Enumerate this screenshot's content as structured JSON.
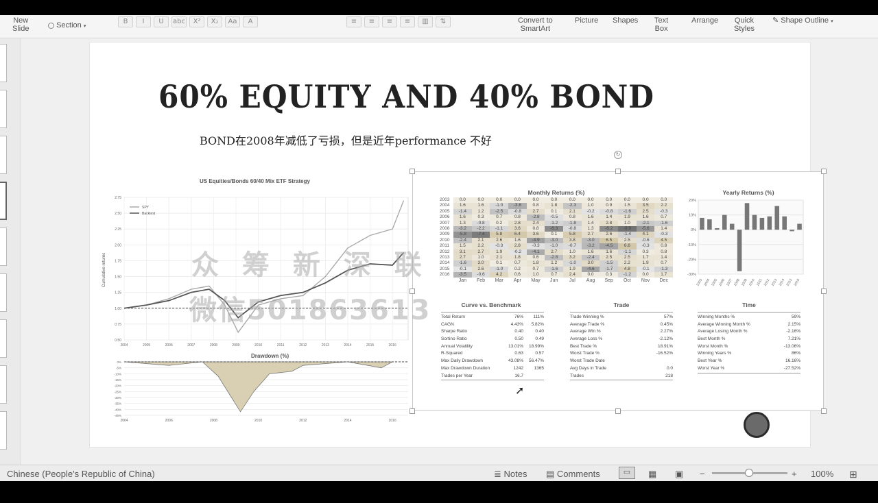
{
  "ribbon": {
    "new_slide": "New\nSlide",
    "section": "Section",
    "format_icons": [
      "B",
      "I",
      "U",
      "abc",
      "X²",
      "X₂",
      "Aa",
      "A"
    ],
    "convert_smartart": "Convert to\nSmartArt",
    "picture": "Picture",
    "shapes": "Shapes",
    "text_box": "Text\nBox",
    "arrange": "Arrange",
    "quick_styles": "Quick\nStyles",
    "shape_outline": "Shape Outline"
  },
  "slide": {
    "title": "60% EQUITY AND 40% BOND",
    "subtitle": "BOND在2008年减低了亏损，但是近年performance 不好"
  },
  "left_chart": {
    "title": "US Equities/Bonds 60/40 Mix ETF Strategy",
    "ylabel": "Cumulative returns",
    "legend": [
      "SPY",
      "Backtest"
    ],
    "yticks": [
      "2.75",
      "2.50",
      "2.25",
      "2.00",
      "1.75",
      "1.50",
      "1.25",
      "1.00",
      "0.75",
      "0.50"
    ],
    "xticks": [
      "2004",
      "2005",
      "2006",
      "2007",
      "2008",
      "2009",
      "2010",
      "2011",
      "2012",
      "2013",
      "2014",
      "2015",
      "2016"
    ],
    "drawdown_title": "Drawdown (%)",
    "dd_yticks": [
      "0%",
      "-5%",
      "-10%",
      "-15%",
      "-20%",
      "-25%",
      "-30%",
      "-35%",
      "-40%",
      "-45%"
    ],
    "dd_xticks": [
      "2004",
      "2006",
      "2008",
      "2010",
      "2012",
      "2014",
      "2016"
    ]
  },
  "chart_data": [
    {
      "type": "line",
      "title": "US Equities/Bonds 60/40 Mix ETF Strategy",
      "ylabel": "Cumulative returns",
      "ylim": [
        0.5,
        2.75
      ],
      "x": [
        2004,
        2005,
        2006,
        2007,
        2007.8,
        2008.5,
        2009.1,
        2010,
        2011,
        2012,
        2013,
        2014,
        2015,
        2016,
        2016.5
      ],
      "series": [
        {
          "name": "SPY",
          "values": [
            1.0,
            1.05,
            1.15,
            1.3,
            1.35,
            1.05,
            0.62,
            1.05,
            1.15,
            1.2,
            1.5,
            1.95,
            2.15,
            2.25,
            2.7
          ]
        },
        {
          "name": "Backtest",
          "values": [
            1.0,
            1.05,
            1.12,
            1.25,
            1.3,
            1.12,
            0.85,
            1.1,
            1.2,
            1.25,
            1.4,
            1.6,
            1.7,
            1.68,
            1.88
          ]
        }
      ]
    },
    {
      "type": "area",
      "title": "Drawdown (%)",
      "ylim": [
        -45,
        0
      ],
      "x": [
        2004,
        2006,
        2007.5,
        2008.2,
        2008.8,
        2009.2,
        2009.8,
        2010.5,
        2011.5,
        2012,
        2014,
        2015.5,
        2016
      ],
      "values": [
        0,
        -3,
        0,
        -12,
        -30,
        -42,
        -25,
        -10,
        -8,
        -3,
        0,
        -5,
        0
      ]
    },
    {
      "type": "bar",
      "title": "Yearly Returns (%)",
      "categories": [
        "2003",
        "2004",
        "2005",
        "2006",
        "2007",
        "2008",
        "2009",
        "2010",
        "2011",
        "2012",
        "2013",
        "2014",
        "2015",
        "2016"
      ],
      "values": [
        8,
        7,
        1,
        10,
        4,
        -28,
        18,
        10,
        8,
        9,
        16,
        9,
        -1,
        4
      ],
      "yticks": [
        "20%",
        "10%",
        "0%",
        "-10%",
        "-20%",
        "-30%"
      ],
      "ylim": [
        -30,
        20
      ]
    }
  ],
  "monthly_returns": {
    "title": "Monthly Returns (%)",
    "months": [
      "Jan",
      "Feb",
      "Mar",
      "Apr",
      "May",
      "Jun",
      "Jul",
      "Aug",
      "Sep",
      "Oct",
      "Nov",
      "Dec"
    ],
    "rows": [
      {
        "year": "2003",
        "cells": [
          "0.0",
          "0.0",
          "0.0",
          "0.0",
          "0.0",
          "0.0",
          "0.0",
          "0.0",
          "0.0",
          "0.0",
          "0.0",
          "0.0"
        ]
      },
      {
        "year": "2004",
        "cells": [
          "1.6",
          "1.6",
          "-1.0",
          "-3.8",
          "0.8",
          "1.8",
          "-2.3",
          "1.0",
          "0.9",
          "1.5",
          "3.5",
          "2.2"
        ]
      },
      {
        "year": "2005",
        "cells": [
          "-1.4",
          "1.2",
          "-2.5",
          "-0.8",
          "2.7",
          "0.1",
          "2.1",
          "-0.2",
          "-0.8",
          "-1.6",
          "2.5",
          "-0.3"
        ]
      },
      {
        "year": "2006",
        "cells": [
          "1.6",
          "0.3",
          "0.7",
          "0.8",
          "-2.8",
          "-0.5",
          "0.8",
          "1.6",
          "1.4",
          "1.9",
          "1.6",
          "0.7"
        ]
      },
      {
        "year": "2007",
        "cells": [
          "1.3",
          "-0.8",
          "0.2",
          "2.8",
          "2.4",
          "-1.2",
          "-1.8",
          "1.4",
          "2.8",
          "1.0",
          "-2.1",
          "-1.6"
        ]
      },
      {
        "year": "2008",
        "cells": [
          "-3.2",
          "-2.2",
          "-1.1",
          "3.6",
          "0.8",
          "-6.3",
          "-0.8",
          "1.3",
          "-6.2",
          "-9.9",
          "-5.6",
          "1.4"
        ]
      },
      {
        "year": "2009",
        "cells": [
          "-5.8",
          "-7.4",
          "5.8",
          "6.4",
          "3.6",
          "0.1",
          "5.8",
          "2.7",
          "2.6",
          "-1.4",
          "4.1",
          "-0.3"
        ]
      },
      {
        "year": "2010",
        "cells": [
          "-2.4",
          "2.1",
          "2.6",
          "1.6",
          "-4.9",
          "-3.0",
          "3.8",
          "-3.0",
          "6.5",
          "2.5",
          "-0.6",
          "4.5"
        ]
      },
      {
        "year": "2011",
        "cells": [
          "1.5",
          "2.2",
          "-0.3",
          "2.8",
          "-0.3",
          "-1.0",
          "-0.7",
          "-3.2",
          "-4.5",
          "6.6",
          "-0.3",
          "0.8"
        ]
      },
      {
        "year": "2012",
        "cells": [
          "3.1",
          "2.7",
          "1.9",
          "-0.2",
          "-4.1",
          "2.7",
          "1.0",
          "1.6",
          "1.6",
          "-1.1",
          "0.3",
          "0.8"
        ]
      },
      {
        "year": "2013",
        "cells": [
          "2.7",
          "1.0",
          "2.1",
          "1.8",
          "0.6",
          "-2.8",
          "3.2",
          "-2.4",
          "2.5",
          "2.5",
          "1.7",
          "1.4"
        ]
      },
      {
        "year": "2014",
        "cells": [
          "-1.6",
          "3.0",
          "0.1",
          "0.7",
          "1.8",
          "1.2",
          "-1.0",
          "3.0",
          "-1.5",
          "2.2",
          "1.9",
          "0.7"
        ]
      },
      {
        "year": "2015",
        "cells": [
          "-0.1",
          "2.6",
          "-1.0",
          "0.2",
          "0.7",
          "-1.6",
          "1.9",
          "-4.6",
          "-1.7",
          "4.8",
          "-0.1",
          "-1.3"
        ]
      },
      {
        "year": "2016",
        "cells": [
          "-3.5",
          "-0.6",
          "4.2",
          "0.6",
          "1.0",
          "0.7",
          "2.4",
          "0.0",
          "0.3",
          "-1.2",
          "0.0",
          "1.7"
        ]
      }
    ]
  },
  "yearly_returns_title": "Yearly Returns (%)",
  "curve_vs_benchmark": {
    "title": "Curve vs. Benchmark",
    "rows": [
      {
        "label": "Total Return",
        "a": "76%",
        "b": "111%"
      },
      {
        "label": "CAGN",
        "a": "4.43%",
        "b": "5.82%"
      },
      {
        "label": "Sharpe Ratio",
        "a": "0.40",
        "b": "0.40"
      },
      {
        "label": "Sortino Ratio",
        "a": "0.50",
        "b": "0.49"
      },
      {
        "label": "Annual Volatility",
        "a": "13.01%",
        "b": "18.99%"
      },
      {
        "label": "R-Squared",
        "a": "0.63",
        "b": "0.57"
      },
      {
        "label": "Max Daily Drawdown",
        "a": "43.08%",
        "b": "56.47%"
      },
      {
        "label": "Max Drawdown Duration",
        "a": "1242",
        "b": "1365"
      },
      {
        "label": "Trades per Year",
        "a": "16.7",
        "b": ""
      }
    ]
  },
  "trade": {
    "title": "Trade",
    "rows": [
      {
        "label": "Trade Winning %",
        "v": "57%"
      },
      {
        "label": "Average Trade %",
        "v": "0.45%"
      },
      {
        "label": "Average Win %",
        "v": "2.27%"
      },
      {
        "label": "Average Loss %",
        "v": "-2.12%"
      },
      {
        "label": "Best Trade %",
        "v": "18.91%"
      },
      {
        "label": "Worst Trade %",
        "v": "-16.52%"
      },
      {
        "label": "Worst Trade Date",
        "v": ""
      },
      {
        "label": "Avg Days in Trade",
        "v": "0.0"
      },
      {
        "label": "Trades",
        "v": "218"
      }
    ]
  },
  "time": {
    "title": "Time",
    "rows": [
      {
        "label": "Winning Months %",
        "v": "59%"
      },
      {
        "label": "Average Winning Month %",
        "v": "2.15%"
      },
      {
        "label": "Average Losing Month %",
        "v": "-2.16%"
      },
      {
        "label": "Best Month %",
        "v": "7.21%"
      },
      {
        "label": "Worst Month %",
        "v": "-13.06%"
      },
      {
        "label": "Winning Years %",
        "v": "86%"
      },
      {
        "label": "Best Year %",
        "v": "16.16%"
      },
      {
        "label": "Worst Year %",
        "v": "-27.52%"
      }
    ]
  },
  "watermark": {
    "line1": "众 筹 新 深 联",
    "line2": "微信501863613"
  },
  "status": {
    "language": "Chinese (People's Republic of China)",
    "notes": "Notes",
    "comments": "Comments",
    "zoom_minus": "−",
    "zoom_plus": "+",
    "zoom": "100%"
  }
}
